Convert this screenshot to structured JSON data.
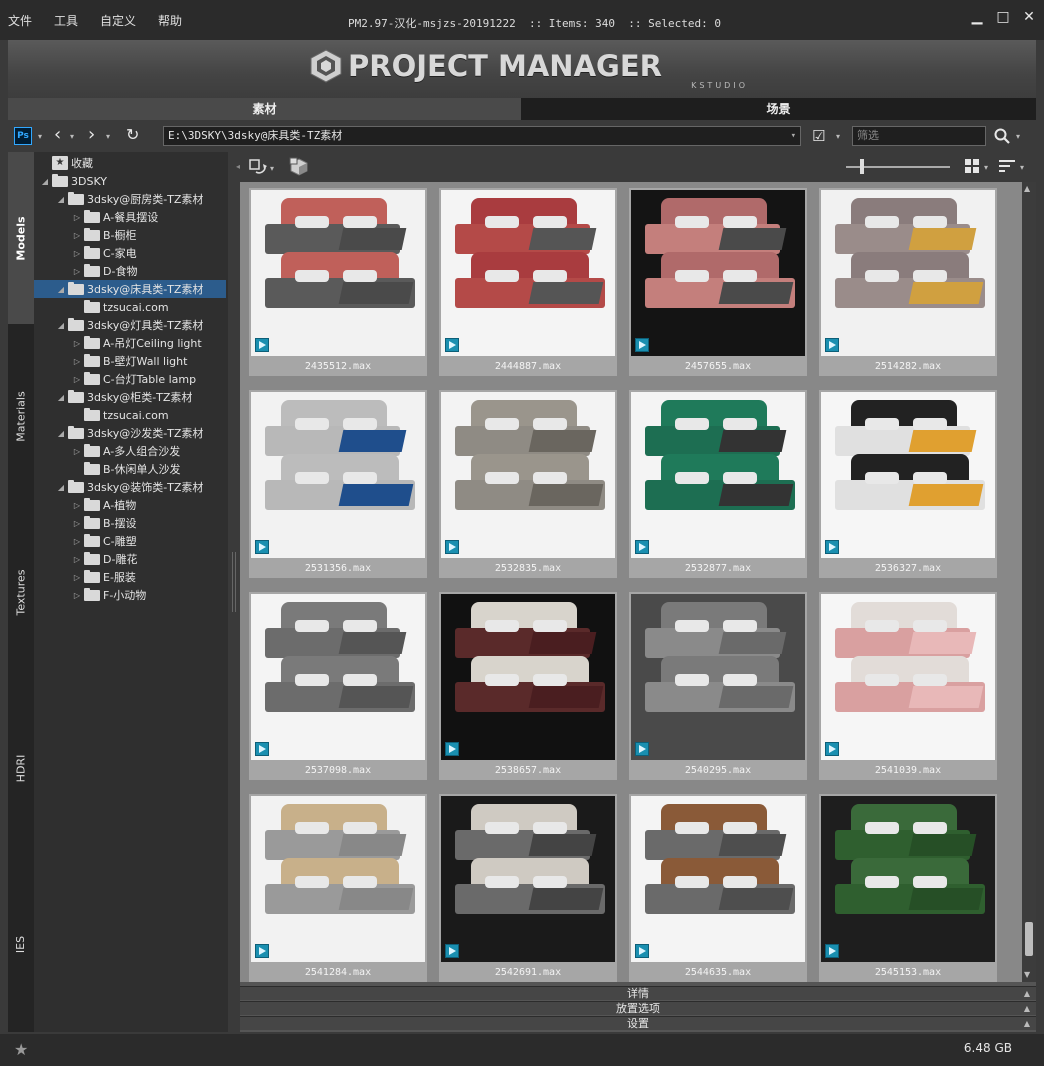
{
  "menu": [
    "文件",
    "工具",
    "自定义",
    "帮助"
  ],
  "window_title": "PM2.97-汉化-msjzs-20191222  :: Items: 340  :: Selected: 0",
  "banner": {
    "title": "PROJECT MANAGER",
    "subtitle": "KSTUDIO"
  },
  "main_tabs": [
    {
      "label": "素材",
      "active": true
    },
    {
      "label": "场景",
      "active": false
    }
  ],
  "address": {
    "path": "E:\\3DSKY\\3dsky@床具类-TZ素材",
    "filter_placeholder": "筛选"
  },
  "side_tabs": [
    "Models",
    "Materials",
    "Textures",
    "HDRI",
    "IES"
  ],
  "tree": [
    {
      "label": "收藏",
      "level": 0,
      "icon": "star-folder-icon",
      "arrow": ""
    },
    {
      "label": "3DSKY",
      "level": 0,
      "arrow": "◢"
    },
    {
      "label": "3dsky@厨房类-TZ素材",
      "level": 1,
      "arrow": "◢"
    },
    {
      "label": "A-餐具摆设",
      "level": 2,
      "arrow": "▷"
    },
    {
      "label": "B-橱柜",
      "level": 2,
      "arrow": "▷"
    },
    {
      "label": "C-家电",
      "level": 2,
      "arrow": "▷"
    },
    {
      "label": "D-食物",
      "level": 2,
      "arrow": "▷"
    },
    {
      "label": "3dsky@床具类-TZ素材",
      "level": 1,
      "arrow": "◢",
      "selected": true
    },
    {
      "label": "tzsucai.com",
      "level": 2,
      "arrow": ""
    },
    {
      "label": "3dsky@灯具类-TZ素材",
      "level": 1,
      "arrow": "◢"
    },
    {
      "label": "A-吊灯Ceiling light",
      "level": 2,
      "arrow": "▷"
    },
    {
      "label": "B-壁灯Wall light",
      "level": 2,
      "arrow": "▷"
    },
    {
      "label": "C-台灯Table lamp",
      "level": 2,
      "arrow": "▷"
    },
    {
      "label": "3dsky@柜类-TZ素材",
      "level": 1,
      "arrow": "◢"
    },
    {
      "label": "tzsucai.com",
      "level": 2,
      "arrow": ""
    },
    {
      "label": "3dsky@沙发类-TZ素材",
      "level": 1,
      "arrow": "◢"
    },
    {
      "label": "A-多人组合沙发",
      "level": 2,
      "arrow": "▷"
    },
    {
      "label": "B-休闲单人沙发",
      "level": 2,
      "arrow": ""
    },
    {
      "label": "3dsky@装饰类-TZ素材",
      "level": 1,
      "arrow": "◢"
    },
    {
      "label": "A-植物",
      "level": 2,
      "arrow": "▷"
    },
    {
      "label": "B-摆设",
      "level": 2,
      "arrow": "▷"
    },
    {
      "label": "C-雕塑",
      "level": 2,
      "arrow": "▷"
    },
    {
      "label": "D-雕花",
      "level": 2,
      "arrow": "▷"
    },
    {
      "label": "E-服装",
      "level": 2,
      "arrow": "▷"
    },
    {
      "label": "F-小动物",
      "level": 2,
      "arrow": "▷"
    }
  ],
  "items": [
    {
      "name": "2435512.max",
      "bg": "#f2f2f2",
      "head": "#c0605a",
      "body": "#5a5a5a",
      "throw": "#4a4a4a"
    },
    {
      "name": "2444887.max",
      "bg": "#f4f4f4",
      "head": "#a93c3f",
      "body": "#b44a48",
      "throw": "#555"
    },
    {
      "name": "2457655.max",
      "bg": "#141414",
      "head": "#b06a6a",
      "body": "#c47f7c",
      "throw": "#4a4a4a"
    },
    {
      "name": "2514282.max",
      "bg": "#f1f1f1",
      "head": "#8a7c7c",
      "body": "#9a8c8a",
      "throw": "#d0a040"
    },
    {
      "name": "2531356.max",
      "bg": "#f2f2f2",
      "head": "#bcbcbc",
      "body": "#b8b8b8",
      "throw": "#1f4e8c"
    },
    {
      "name": "2532835.max",
      "bg": "#f3f3f3",
      "head": "#9a958c",
      "body": "#8f8b84",
      "throw": "#6a665f"
    },
    {
      "name": "2532877.max",
      "bg": "#f4f4f4",
      "head": "#1f7a5a",
      "body": "#1d6e52",
      "throw": "#333"
    },
    {
      "name": "2536327.max",
      "bg": "#f6f6f6",
      "head": "#222222",
      "body": "#e0e0e0",
      "throw": "#e0a030"
    },
    {
      "name": "2537098.max",
      "bg": "#f4f4f4",
      "head": "#7a7a7a",
      "body": "#6c6c6c",
      "throw": "#555"
    },
    {
      "name": "2538657.max",
      "bg": "#111111",
      "head": "#d8d4cc",
      "body": "#5a2a2a",
      "throw": "#4a1e20"
    },
    {
      "name": "2540295.max",
      "bg": "#4a4a4a",
      "head": "#7a7a7a",
      "body": "#8a8a8a",
      "throw": "#6a6a6a"
    },
    {
      "name": "2541039.max",
      "bg": "#f6f6f6",
      "head": "#e2dcd8",
      "body": "#d9a0a0",
      "throw": "#e8b8b8"
    },
    {
      "name": "2541284.max",
      "bg": "#f2f2f2",
      "head": "#c8b08a",
      "body": "#9a9a9a",
      "throw": "#888"
    },
    {
      "name": "2542691.max",
      "bg": "#1a1a1a",
      "head": "#cfcac2",
      "body": "#6a6a6a",
      "throw": "#444"
    },
    {
      "name": "2544635.max",
      "bg": "#f4f4f4",
      "head": "#8a5a38",
      "body": "#6a6a6a",
      "throw": "#4e4e4e"
    },
    {
      "name": "2545153.max",
      "bg": "#1e1e1e",
      "head": "#3a6a3a",
      "body": "#2f5f2f",
      "throw": "#264f26"
    }
  ],
  "bottom_panels": [
    "详情",
    "放置选项",
    "设置"
  ],
  "status": {
    "disk": "6.48 GB"
  }
}
